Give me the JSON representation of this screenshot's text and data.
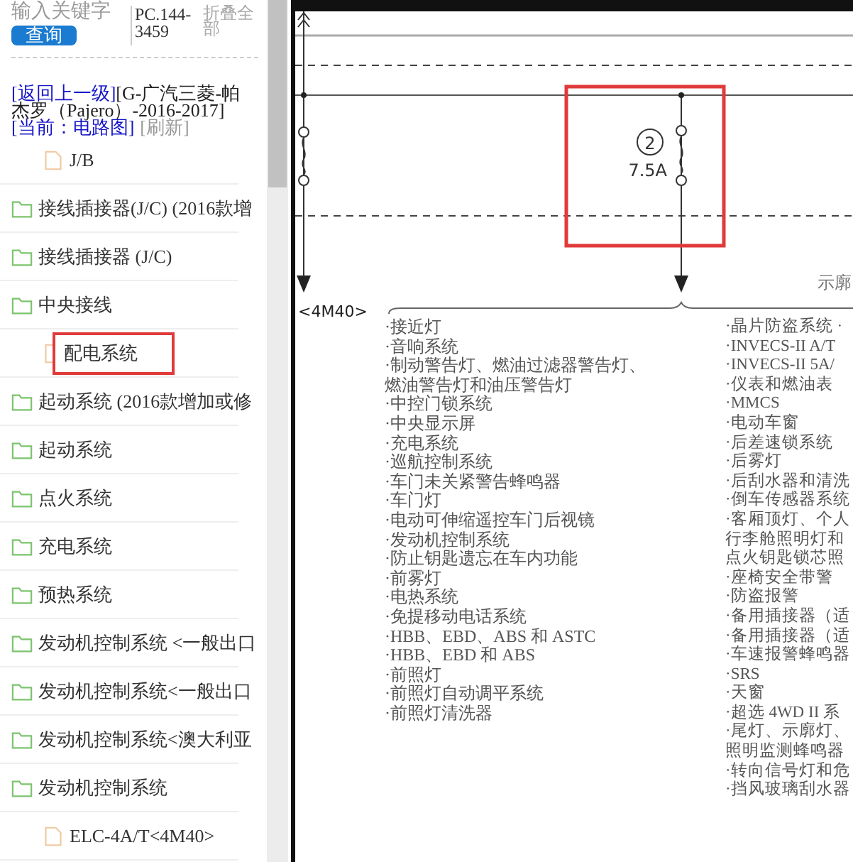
{
  "search": {
    "placeholder": "输入关键字",
    "button": "查询",
    "code": "PC.144-3459",
    "collapse_all": "折叠全部"
  },
  "breadcrumb": {
    "back": "[返回上一级]",
    "vehicle": "[G-广汽三菱-帕杰罗（Pajero）-2016-2017]",
    "current": "[当前：电路图]",
    "refresh": "[刷新]"
  },
  "tree": [
    {
      "kind": "file",
      "label": "J/B",
      "highlighted": false
    },
    {
      "kind": "folder",
      "label": "接线插接器(J/C) (2016款增",
      "highlighted": false
    },
    {
      "kind": "folder",
      "label": "接线插接器 (J/C)",
      "highlighted": false
    },
    {
      "kind": "folder",
      "label": "中央接线",
      "highlighted": false,
      "children": [
        {
          "kind": "file",
          "label": "配电系统",
          "highlighted": true
        }
      ]
    },
    {
      "kind": "folder",
      "label": "起动系统 (2016款增加或修",
      "highlighted": false
    },
    {
      "kind": "folder",
      "label": "起动系统",
      "highlighted": false
    },
    {
      "kind": "folder",
      "label": "点火系统",
      "highlighted": false
    },
    {
      "kind": "folder",
      "label": "充电系统",
      "highlighted": false
    },
    {
      "kind": "folder",
      "label": "预热系统",
      "highlighted": false
    },
    {
      "kind": "folder",
      "label": "发动机控制系统 <一般出口",
      "highlighted": false
    },
    {
      "kind": "folder",
      "label": "发动机控制系统<一般出口",
      "highlighted": false
    },
    {
      "kind": "folder",
      "label": "发动机控制系统<澳大利亚",
      "highlighted": false
    },
    {
      "kind": "folder",
      "label": "发动机控制系统",
      "highlighted": false,
      "children": [
        {
          "kind": "file",
          "label": "ELC-4A/T<4M40>",
          "highlighted": false
        }
      ]
    }
  ],
  "diagram": {
    "fuse_number": "2",
    "fuse_rating": "7.5A",
    "label_right": "示廓",
    "engine_tag": "<4M40>",
    "left_column": [
      "·接近灯",
      "·音响系统",
      "·制动警告灯、燃油过滤器警告灯、",
      "燃油警告灯和油压警告灯",
      "·中控门锁系统",
      "·中央显示屏",
      "·充电系统",
      "·巡航控制系统",
      "·车门未关紧警告蜂鸣器",
      "·车门灯",
      "·电动可伸缩遥控车门后视镜",
      "·发动机控制系统",
      "·防止钥匙遗忘在车内功能",
      "·前雾灯",
      "·电热系统",
      "·免提移动电话系统",
      "·HBB、EBD、ABS 和 ASTC",
      "·HBB、EBD 和 ABS",
      "·前照灯",
      "·前照灯自动调平系统",
      "·前照灯清洗器"
    ],
    "right_column": [
      "·晶片防盗系统 ·",
      "·INVECS-II A/T",
      "·INVECS-II 5A/",
      "·仪表和燃油表",
      "·MMCS",
      "·电动车窗",
      "·后差速锁系统",
      "·后雾灯",
      "·后刮水器和清洗",
      "·倒车传感器系统",
      "·客厢顶灯、个人",
      "行李舱照明灯和",
      "点火钥匙锁芯照",
      "·座椅安全带警",
      "·防盗报警",
      "·备用插接器（适",
      "·备用插接器（适",
      "·车速报警蜂鸣器",
      "·SRS",
      "·天窗",
      "·超选 4WD II 系",
      "·尾灯、示廓灯、",
      "照明监测蜂鸣器",
      "·转向信号灯和危",
      "·挡风玻璃刮水器"
    ]
  }
}
